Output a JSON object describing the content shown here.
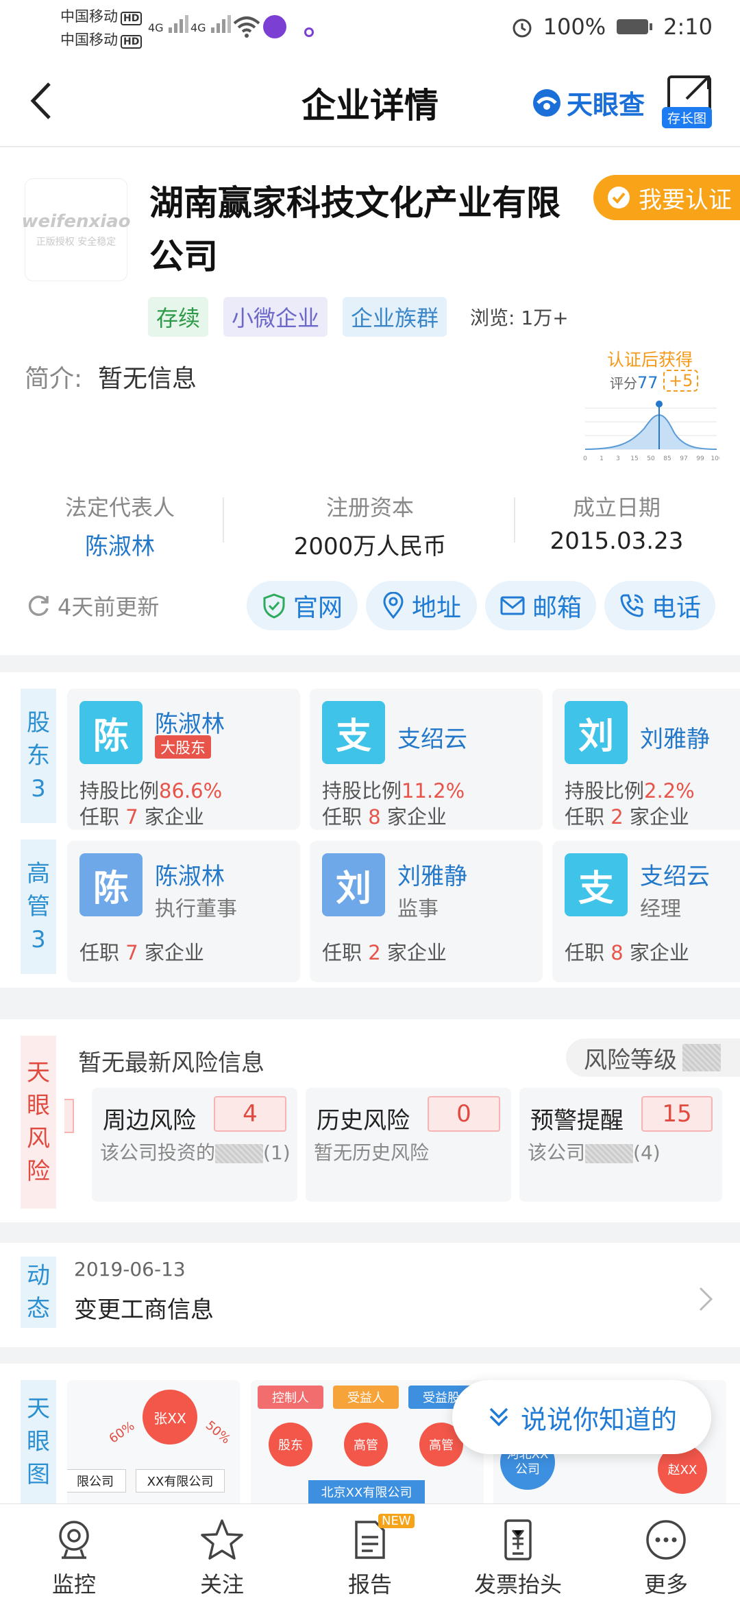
{
  "status_bar": {
    "carrier1": "中国移动",
    "carrier2": "中国移动",
    "hd": "HD",
    "net": "4G",
    "battery": "100%",
    "time": "2:10"
  },
  "header": {
    "title": "企业详情",
    "brand": "天眼查",
    "long_image_label": "存长图"
  },
  "company": {
    "logo_text": "weifenxiao",
    "logo_sub": "正版授权 安全稳定",
    "name": "湖南赢家科技文化产业有限公司",
    "certify_label": "我要认证",
    "tags": [
      "存续",
      "小微企业",
      "企业族群"
    ],
    "views": "浏览: 1万+",
    "intro_label": "简介:",
    "intro_value": "暂无信息",
    "score_chart": {
      "title": "认证后获得",
      "score_label": "评分",
      "score": "77",
      "bonus": "+5",
      "ticks": [
        "0",
        "1",
        "3",
        "15",
        "50",
        "85",
        "97",
        "99",
        "100"
      ]
    },
    "stats": [
      {
        "label": "法定代表人",
        "value": "陈淑林"
      },
      {
        "label": "注册资本",
        "value": "2000万人民币"
      },
      {
        "label": "成立日期",
        "value": "2015.03.23"
      }
    ],
    "update": "4天前更新",
    "actions": [
      "官网",
      "地址",
      "邮箱",
      "电话"
    ]
  },
  "shareholders": {
    "side": [
      "股",
      "东",
      "3"
    ],
    "items": [
      {
        "avatar": "陈",
        "name": "陈淑林",
        "badge": "大股东",
        "ratio_label": "持股比例",
        "ratio": "86.6%",
        "job_pre": "任职 ",
        "job_num": "7",
        "job_post": " 家企业"
      },
      {
        "avatar": "支",
        "name": "支绍云",
        "ratio_label": "持股比例",
        "ratio": "11.2%",
        "job_pre": "任职 ",
        "job_num": "8",
        "job_post": " 家企业"
      },
      {
        "avatar": "刘",
        "name": "刘雅静",
        "ratio_label": "持股比例",
        "ratio": "2.2%",
        "job_pre": "任职 ",
        "job_num": "2",
        "job_post": " 家企业"
      }
    ]
  },
  "executives": {
    "side": [
      "高",
      "管",
      "3"
    ],
    "items": [
      {
        "avatar": "陈",
        "name": "陈淑林",
        "role": "执行董事",
        "job_pre": "任职 ",
        "job_num": "7",
        "job_post": " 家企业"
      },
      {
        "avatar": "刘",
        "name": "刘雅静",
        "role": "监事",
        "job_pre": "任职 ",
        "job_num": "2",
        "job_post": " 家企业"
      },
      {
        "avatar": "支",
        "name": "支绍云",
        "role": "经理",
        "job_pre": "任职 ",
        "job_num": "8",
        "job_post": " 家企业"
      }
    ]
  },
  "risk": {
    "side": [
      "天",
      "眼",
      "风",
      "险"
    ],
    "headline": "暂无最新风险信息",
    "level_label": "风险等级",
    "cards": [
      {
        "title": "周边风险",
        "num": "4",
        "desc_pre": "该公司投资的",
        "desc_post": "(1)"
      },
      {
        "title": "历史风险",
        "num": "0",
        "desc_pre": "暂无历史风险",
        "desc_post": ""
      },
      {
        "title": "预警提醒",
        "num": "15",
        "desc_pre": "该公司",
        "desc_post": "(4)"
      }
    ]
  },
  "news": {
    "side": [
      "动",
      "态"
    ],
    "date": "2019-06-13",
    "text": "变更工商信息"
  },
  "graph": {
    "side": [
      "天",
      "眼",
      "图"
    ],
    "card1": {
      "center": "张XX",
      "pct1": "60%",
      "pct2": "50%",
      "box1": "限公司",
      "box2": "XX有限公司"
    },
    "card2": {
      "labels": [
        "控制人",
        "受益人",
        "受益股"
      ],
      "nodes": [
        "股东",
        "高管",
        "高管"
      ],
      "company": "北京XX有限公司"
    },
    "card3": {
      "node1": "河北XX公司",
      "node2": "赵XX"
    }
  },
  "fab_label": "说说你知道的",
  "tabs": [
    {
      "label": "监控",
      "icon": "monitor-icon"
    },
    {
      "label": "关注",
      "icon": "star-icon"
    },
    {
      "label": "报告",
      "icon": "report-icon",
      "badge": "NEW"
    },
    {
      "label": "发票抬头",
      "icon": "invoice-icon"
    },
    {
      "label": "更多",
      "icon": "more-icon"
    }
  ],
  "colors": {
    "brand_blue": "#1f7bd3",
    "accent_orange": "#f8a318",
    "risk_red": "#e04a3f"
  }
}
